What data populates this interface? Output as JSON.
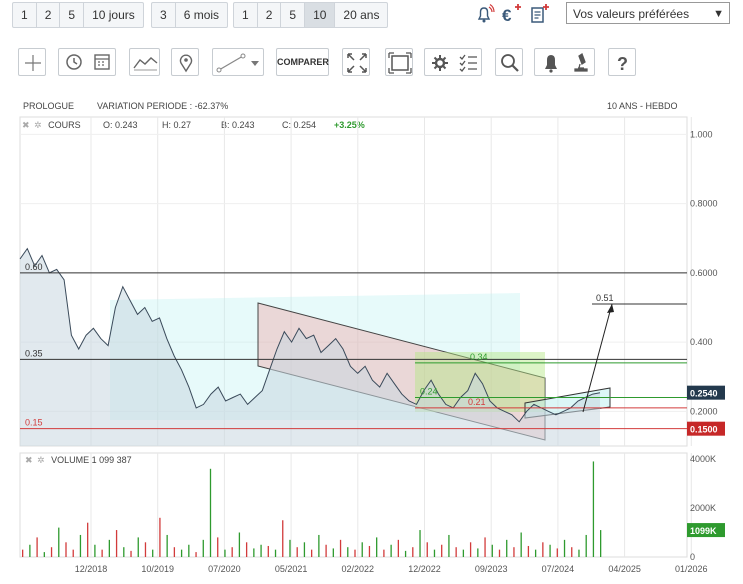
{
  "period_groups": [
    {
      "buttons": [
        "1",
        "2",
        "5",
        "10 jours"
      ]
    },
    {
      "buttons": [
        "3",
        "6 mois"
      ]
    },
    {
      "buttons": [
        "1",
        "2",
        "5",
        "10",
        "20 ans"
      ],
      "active": "10"
    }
  ],
  "select": {
    "value": "Vos valeurs préférées"
  },
  "toolbar": {
    "comparer_label": "COMPARER"
  },
  "header": {
    "name": "PROLOGUE",
    "variation": "VARIATION PERIODE : -62.37%",
    "period": "10 ANS - HEBDO"
  },
  "legend": {
    "cours": "COURS",
    "open": "O: 0.243",
    "high": "H: 0.27",
    "low": "B: 0.243",
    "close": "C: 0.254",
    "change": "+3.25%",
    "volume": "VOLUME 1 099 387"
  },
  "colors": {
    "up": "#2e9a2e",
    "down": "#d23b3b",
    "line": "#3a4a5a",
    "area": "#c9d7e0"
  },
  "chart_data": [
    {
      "type": "area",
      "x_ticks": [
        "12/2018",
        "10/2019",
        "07/2020",
        "05/2021",
        "02/2022",
        "12/2022",
        "09/2023",
        "07/2024",
        "04/2025",
        "01/2026"
      ],
      "ylim": [
        0.1,
        1.05
      ],
      "y_ticks": [
        "1.000",
        "0.8000",
        "0.6000",
        "0.400",
        "0.2000"
      ],
      "y_tick_values": [
        1.0,
        0.8,
        0.6,
        0.4,
        0.2
      ],
      "series": [
        {
          "values": [
            0.64,
            0.67,
            0.62,
            0.65,
            0.6,
            0.61,
            0.58,
            0.42,
            0.38,
            0.42,
            0.44,
            0.41,
            0.39,
            0.5,
            0.56,
            0.52,
            0.48,
            0.5,
            0.46,
            0.47,
            0.41,
            0.36,
            0.32,
            0.27,
            0.21,
            0.22,
            0.25,
            0.27,
            0.23,
            0.24,
            0.25,
            0.22,
            0.24,
            0.26,
            0.32,
            0.38,
            0.43,
            0.4,
            0.44,
            0.41,
            0.42,
            0.37,
            0.39,
            0.41,
            0.38,
            0.33,
            0.31,
            0.33,
            0.29,
            0.27,
            0.31,
            0.28,
            0.25,
            0.23,
            0.22,
            0.26,
            0.29,
            0.25,
            0.22,
            0.21,
            0.24,
            0.26,
            0.31,
            0.28,
            0.23,
            0.21,
            0.2,
            0.19,
            0.17,
            0.2,
            0.22,
            0.21,
            0.2,
            0.19,
            0.2,
            0.21,
            0.23,
            0.24,
            0.25,
            0.254
          ]
        }
      ],
      "horizontal_lines": [
        {
          "label": "0.60",
          "value": 0.6
        },
        {
          "label": "0.35",
          "value": 0.35
        },
        {
          "label": "0.15",
          "value": 0.15
        },
        {
          "label": "0.34",
          "value": 0.34
        },
        {
          "label": "0.24",
          "value": 0.24
        },
        {
          "label": "0.21",
          "value": 0.21
        },
        {
          "label": "0.51",
          "value": 0.51
        }
      ],
      "price_tags": [
        {
          "label": "0.2540",
          "value": 0.254,
          "color": "#23394d"
        },
        {
          "label": "0.1500",
          "value": 0.15,
          "color": "#c62828"
        }
      ]
    },
    {
      "type": "bar",
      "title": "VOLUME 1 099 387",
      "ylim": [
        0,
        4000
      ],
      "y_ticks": [
        "4000K",
        "2000K",
        "0"
      ],
      "y_tick_values": [
        4000,
        2000,
        0
      ],
      "last_value_label": "1099K",
      "values": [
        300,
        500,
        800,
        200,
        400,
        1200,
        600,
        300,
        900,
        1400,
        500,
        300,
        700,
        1100,
        400,
        250,
        800,
        600,
        300,
        1600,
        900,
        400,
        300,
        500,
        200,
        700,
        3600,
        800,
        300,
        400,
        1000,
        600,
        350,
        500,
        450,
        300,
        1500,
        700,
        400,
        600,
        300,
        900,
        500,
        350,
        700,
        400,
        300,
        600,
        450,
        800,
        300,
        500,
        700,
        250,
        400,
        1100,
        600,
        300,
        500,
        900,
        400,
        300,
        600,
        350,
        800,
        500,
        300,
        700,
        400,
        1000,
        450,
        300,
        600,
        500,
        350,
        700,
        400,
        300,
        900,
        3900,
        1099
      ],
      "directions": [
        "d",
        "u",
        "d",
        "u",
        "d",
        "u",
        "d",
        "d",
        "u",
        "d",
        "u",
        "d",
        "u",
        "d",
        "u",
        "d",
        "u",
        "d",
        "u",
        "d",
        "u",
        "d",
        "u",
        "u",
        "d",
        "u",
        "u",
        "d",
        "u",
        "d",
        "u",
        "d",
        "u",
        "u",
        "d",
        "u",
        "d",
        "u",
        "d",
        "u",
        "d",
        "u",
        "d",
        "u",
        "d",
        "u",
        "d",
        "u",
        "d",
        "u",
        "d",
        "u",
        "d",
        "u",
        "d",
        "u",
        "d",
        "u",
        "d",
        "u",
        "d",
        "u",
        "d",
        "u",
        "d",
        "u",
        "d",
        "u",
        "d",
        "u",
        "d",
        "u",
        "d",
        "u",
        "d",
        "u",
        "d",
        "u",
        "u",
        "u",
        "u"
      ]
    }
  ]
}
